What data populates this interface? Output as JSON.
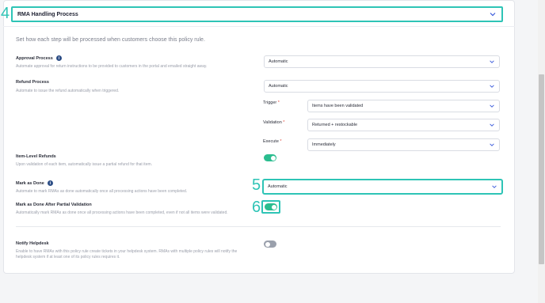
{
  "header": {
    "title": "RMA Handling Process"
  },
  "description": "Set how each step will be processed when customers choose this policy rule.",
  "approval": {
    "label": "Approval Process",
    "sub": "Automate approval for return instructions to be provided to customers in the portal and emailed straight away.",
    "value": "Automatic"
  },
  "refund": {
    "label": "Refund Process",
    "sub": "Automate to issue the refund automatically when triggered.",
    "value": "Automatic",
    "trigger_label": "Trigger",
    "trigger_value": "Items have been validated",
    "validation_label": "Validation",
    "validation_value": "Returned + restockable",
    "execute_label": "Execute",
    "execute_value": "Immediately",
    "required_mark": "*"
  },
  "item_level": {
    "label": "Item-Level Refunds",
    "sub": "Upon validation of each item, automatically issue a partial refund for that item.",
    "enabled": true
  },
  "mark_done": {
    "label": "Mark as Done",
    "sub": "Automate to mark RMAs as done automatically once all processing actions have been completed.",
    "value": "Automatic"
  },
  "mark_done_partial": {
    "label": "Mark as Done After Partial Validation",
    "sub": "Automatically mark RMAs as done once all processing actions have been completed, even if not all items were validated.",
    "enabled": true
  },
  "helpdesk": {
    "label": "Notify Helpdesk",
    "sub": "Enable to have RMAs with this policy rule create tickets in your helpdesk system. RMAs with multiple policy rules will notify the helpdesk system if at least one of its policy rules requires it.",
    "enabled": false
  },
  "annotations": {
    "step4": "4",
    "step5": "5",
    "step6": "6"
  },
  "colors": {
    "accent": "#2ec4b6",
    "toggle_on": "#2bbd8f",
    "toggle_off": "#9aa0ac",
    "info": "#2d4e86"
  }
}
